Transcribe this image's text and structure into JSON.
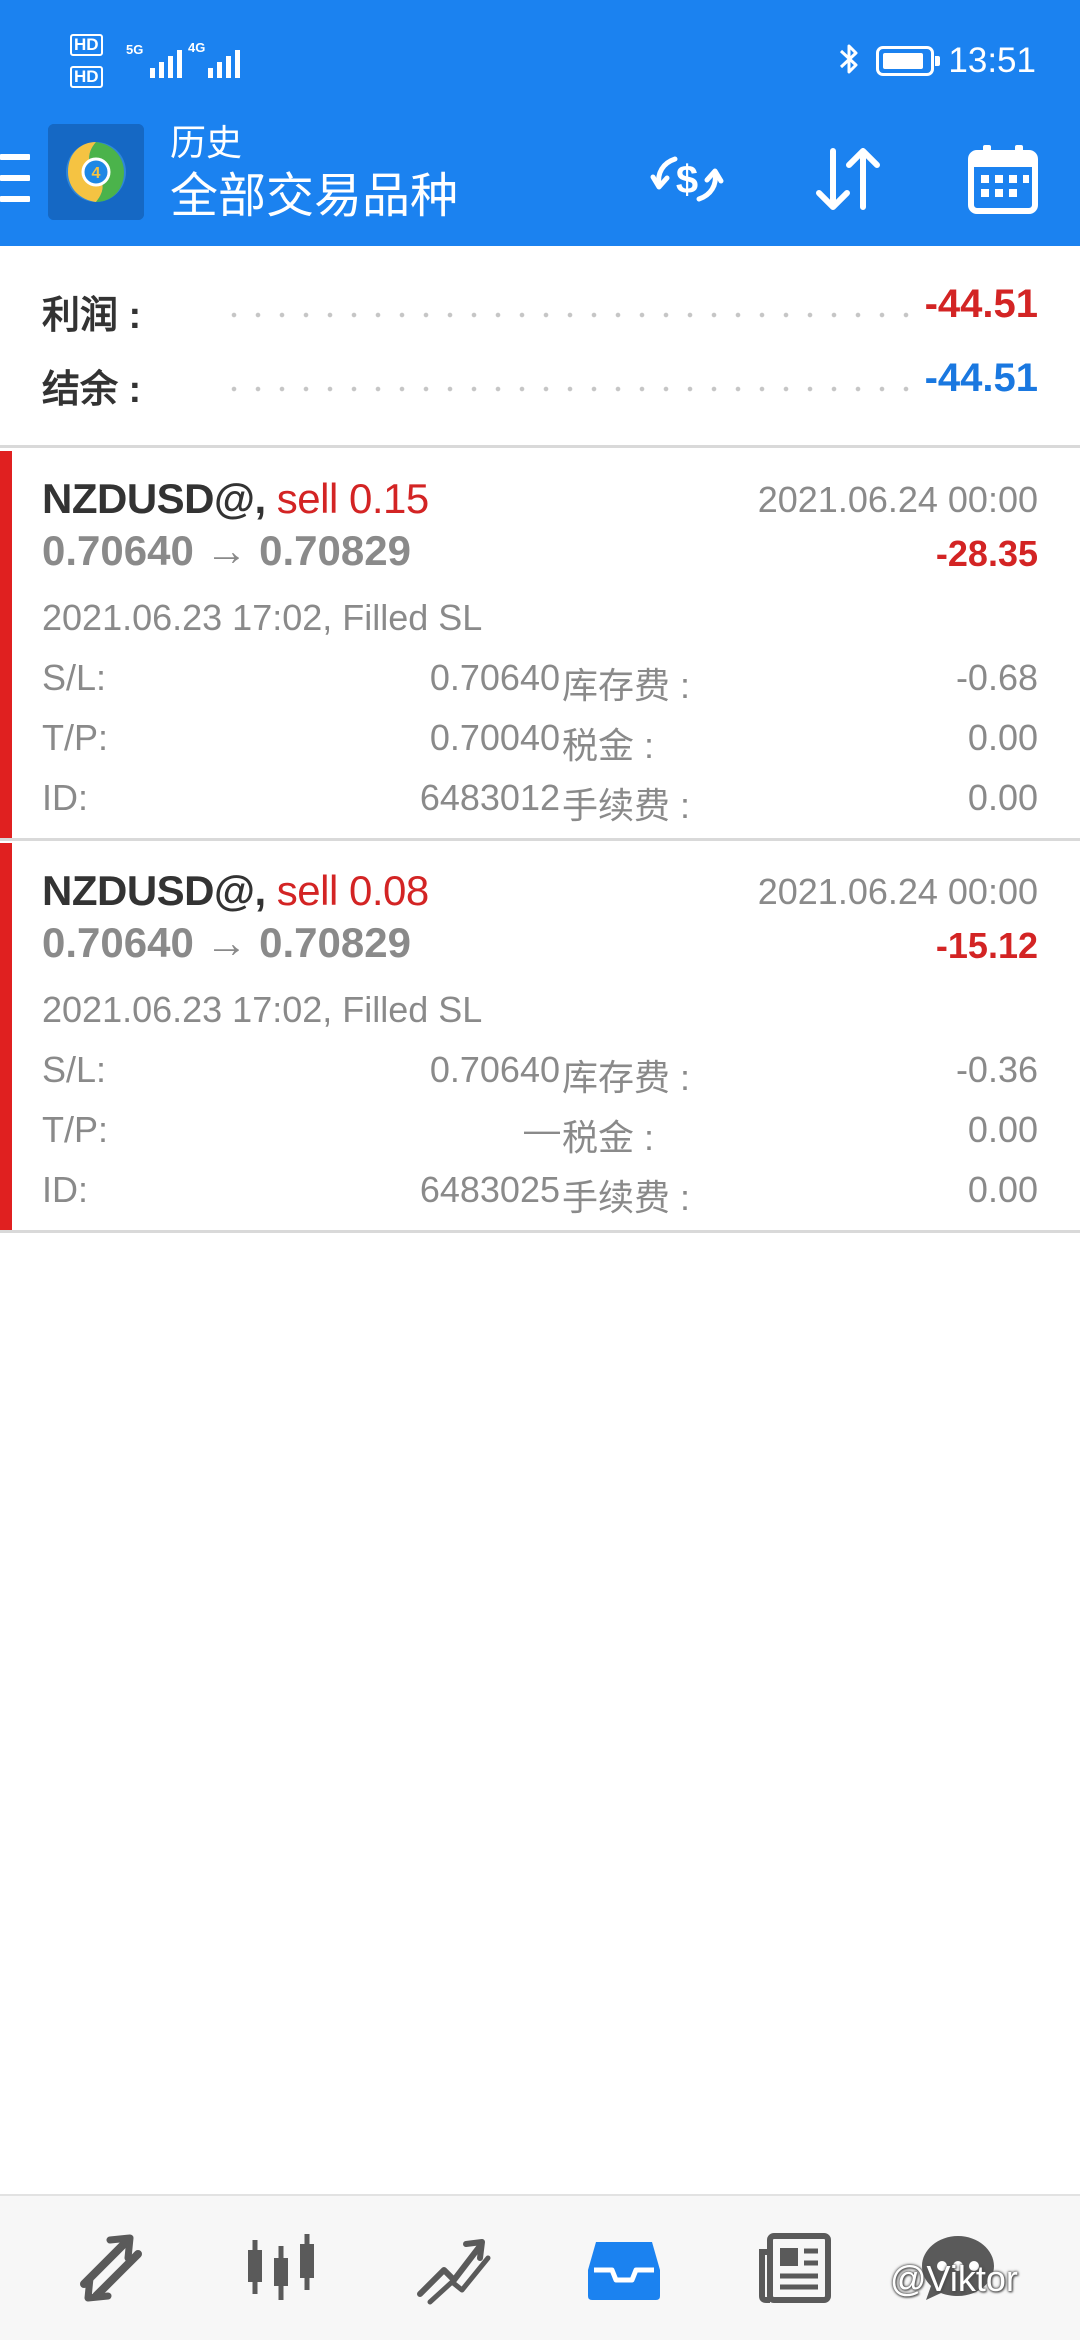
{
  "status_bar": {
    "hd1": "HD",
    "hd2": "HD",
    "net1": "5G",
    "net2": "4G",
    "time": "13:51"
  },
  "app_bar": {
    "title": "历史",
    "subtitle": "全部交易品种",
    "icons": [
      "menu-icon",
      "metatrader-logo",
      "currency-exchange-icon",
      "sort-icon",
      "calendar-icon"
    ]
  },
  "summary": {
    "profit_label": "利润 :",
    "profit_value": "-44.51",
    "balance_label": "结余 :",
    "balance_value": "-44.51"
  },
  "deals": [
    {
      "symbol": "NZDUSD@,",
      "side": "sell 0.15",
      "close_time": "2021.06.24 00:00",
      "prices": "0.70640 → 0.70829",
      "profit": "-28.35",
      "open_info": "2021.06.23 17:02, Filled SL",
      "sl_label": "S/L:",
      "sl_value": "0.70640",
      "swap_label": "库存费 :",
      "swap_value": "-0.68",
      "tp_label": "T/P:",
      "tp_value": "0.70040",
      "tax_label": "税金 :",
      "tax_value": "0.00",
      "id_label": "ID:",
      "id_value": "6483012",
      "fee_label": "手续费 :",
      "fee_value": "0.00"
    },
    {
      "symbol": "NZDUSD@,",
      "side": "sell 0.08",
      "close_time": "2021.06.24 00:00",
      "prices": "0.70640 → 0.70829",
      "profit": "-15.12",
      "open_info": "2021.06.23 17:02, Filled SL",
      "sl_label": "S/L:",
      "sl_value": "0.70640",
      "swap_label": "库存费 :",
      "swap_value": "-0.36",
      "tp_label": "T/P:",
      "tp_value": "—",
      "tax_label": "税金 :",
      "tax_value": "0.00",
      "id_label": "ID:",
      "id_value": "6483025",
      "fee_label": "手续费 :",
      "fee_value": "0.00"
    }
  ],
  "bottom_nav": {
    "items": [
      "trade-icon",
      "quotes-icon",
      "chart-icon",
      "history-icon",
      "news-icon",
      "chat-icon"
    ],
    "active": "history-icon"
  },
  "watermark": "@Viktor",
  "colors": {
    "header_bg": "#1b82f0",
    "negative_red": "#d32424",
    "balance_blue": "#1a78e0",
    "deal_marker": "#e02020",
    "nav_active": "#1b82f0",
    "nav_inactive": "#5a5a5a"
  }
}
